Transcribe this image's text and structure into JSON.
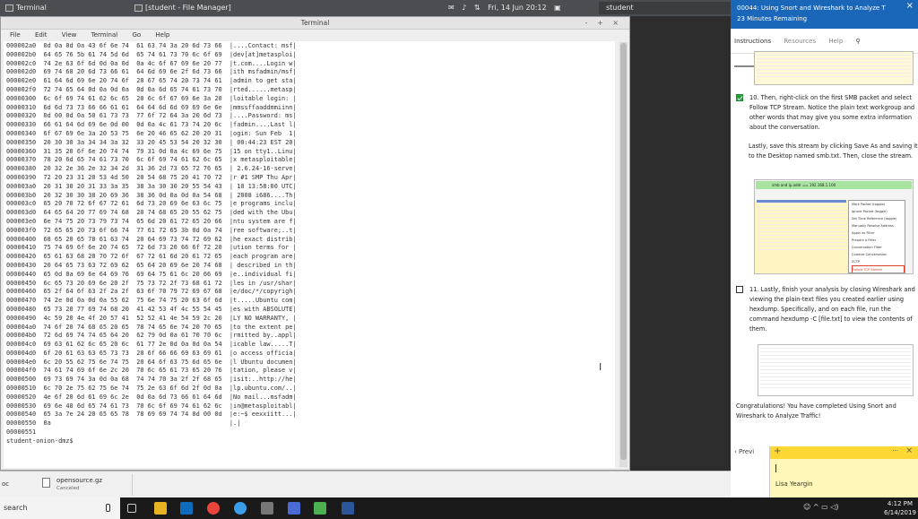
{
  "topbar": {
    "terminal_title": "Terminal",
    "file_manager_title": "[student - File Manager]",
    "datetime": "Fri, 14 Jun  20:12",
    "user": "student"
  },
  "terminal": {
    "title": "Terminal",
    "controls": "- + ×",
    "menu": [
      "File",
      "Edit",
      "View",
      "Terminal",
      "Go",
      "Help"
    ],
    "lines": [
      "000002a0  0d 0a 0d 0a 43 6f 6e 74  61 63 74 3a 20 6d 73 66  |....Contact: msf|",
      "000002b0  64 65 76 5b 61 74 5d 6d  65 74 61 73 70 6c 6f 69  |dev[at]metasploi|",
      "000002c0  74 2e 63 6f 6d 0d 0a 0d  0a 4c 6f 67 69 6e 20 77  |t.com....Login w|",
      "000002d0  69 74 68 20 6d 73 66 61  64 6d 69 6e 2f 6d 73 66  |ith msfadmin/msf|",
      "000002e0  61 64 6d 69 6e 20 74 6f  20 67 65 74 20 73 74 61  |admin to get sta|",
      "000002f0  72 74 65 64 0d 0a 0d 0a  0d 0a 6d 65 74 61 73 70  |rted......metasp|",
      "00000300  6c 6f 69 74 61 62 6c 65  20 6c 6f 67 69 6e 3a 20  |loitable login: |",
      "00000310  6d 6d 73 73 66 66 61 61  64 64 6d 6d 69 69 6e 6e  |mmssffaaddmmiinn|",
      "00000320  0d 00 0d 0a 50 61 73 73  77 6f 72 64 3a 20 6d 73  |....Password: ms|",
      "00000330  66 61 64 6d 69 6e 0d 00  0d 0a 4c 61 73 74 20 6c  |fadmin....Last l|",
      "00000340  6f 67 69 6e 3a 20 53 75  6e 20 46 65 62 20 20 31  |ogin: Sun Feb  1|",
      "00000350  20 30 30 3a 34 34 3a 32  33 20 45 53 54 20 32 30  | 00:44:23 EST 20|",
      "00000360  31 35 20 6f 6e 20 74 74  79 31 0d 0a 4c 69 6e 75  |15 on tty1..Linu|",
      "00000370  78 20 6d 65 74 61 73 70  6c 6f 69 74 61 62 6c 65  |x metasploitable|",
      "00000380  20 32 2e 36 2e 32 34 2d  31 36 2d 73 65 72 76 65  | 2.6.24-16-serve|",
      "00000390  72 20 23 31 20 53 4d 50  20 54 68 75 20 41 70 72  |r #1 SMP Thu Apr|",
      "000003a0  20 31 30 20 31 33 3a 35  38 3a 30 30 20 55 54 43  | 10 13:58:00 UTC|",
      "000003b0  20 32 30 30 38 20 69 36  38 36 0d 0a 0d 0a 54 68  | 2008 i686....Th|",
      "000003c0  65 20 70 72 6f 67 72 61  6d 73 20 69 6e 63 6c 75  |e programs inclu|",
      "000003d0  64 65 64 20 77 69 74 68  20 74 68 65 20 55 62 75  |ded with the Ubu|",
      "000003e0  6e 74 75 20 73 79 73 74  65 6d 20 61 72 65 20 66  |ntu system are f|",
      "000003f0  72 65 65 20 73 6f 66 74  77 61 72 65 3b 0d 0a 74  |ree software;..t|",
      "00000400  68 65 20 65 78 61 63 74  20 64 69 73 74 72 69 62  |he exact distrib|",
      "00000410  75 74 69 6f 6e 20 74 65  72 6d 73 20 66 6f 72 20  |ution terms for |",
      "00000420  65 61 63 68 20 70 72 6f  67 72 61 6d 20 61 72 65  |each program are|",
      "00000430  20 64 65 73 63 72 69 62  65 64 20 69 6e 20 74 68  | described in th|",
      "00000440  65 0d 0a 69 6e 64 69 76  69 64 75 61 6c 20 66 69  |e..individual fi|",
      "00000450  6c 65 73 20 69 6e 20 2f  75 73 72 2f 73 68 61 72  |les in /usr/shar|",
      "00000460  65 2f 64 6f 63 2f 2a 2f  63 6f 70 79 72 69 67 68  |e/doc/*/copyrigh|",
      "00000470  74 2e 0d 0a 0d 0a 55 62  75 6e 74 75 20 63 6f 6d  |t.....Ubuntu com|",
      "00000480  65 73 20 77 69 74 68 20  41 42 53 4f 4c 55 54 45  |es with ABSOLUTE|",
      "00000490  4c 59 20 4e 4f 20 57 41  52 52 41 4e 54 59 2c 20  |LY NO WARRANTY, |",
      "000004a0  74 6f 20 74 68 65 20 65  78 74 65 6e 74 20 70 65  |to the extent pe|",
      "000004b0  72 6d 69 74 74 65 64 20  62 79 0d 0a 61 70 70 6c  |rmitted by..appl|",
      "000004c0  69 63 61 62 6c 65 20 6c  61 77 2e 0d 0a 0d 0a 54  |icable law.....T|",
      "000004d0  6f 20 61 63 63 65 73 73  20 6f 66 66 69 63 69 61  |o access officia|",
      "000004e0  6c 20 55 62 75 6e 74 75  20 64 6f 63 75 6d 65 6e  |l Ubuntu documen|",
      "000004f0  74 61 74 69 6f 6e 2c 20  70 6c 65 61 73 65 20 76  |tation, please v|",
      "00000500  69 73 69 74 3a 0d 0a 68  74 74 70 3a 2f 2f 68 65  |isit:..http://he|",
      "00000510  6c 70 2e 75 62 75 6e 74  75 2e 63 6f 6d 2f 0d 0a  |lp.ubuntu.com/..|",
      "00000520  4e 6f 20 6d 61 69 6c 2e  0d 0a 6d 73 66 61 64 6d  |No mail...msfadm|",
      "00000530  69 6e 40 6d 65 74 61 73  70 6c 6f 69 74 61 62 6c  |in@metasploitabl|",
      "00000540  65 3a 7e 24 20 65 65 78  78 69 69 74 74 0d 00 0d  |e:~$ eexxiitt...|",
      "00000550  0a                                                |.|",
      "00000551",
      "student-onion-dmz$"
    ]
  },
  "panel": {
    "title": "00044: Using Snort and Wireshark to Analyze T",
    "remaining": "23 Minutes Remaining",
    "tabs": [
      "Instructions",
      "Resources",
      "Help"
    ],
    "step10": {
      "number": "10.",
      "text": "Then, right-click on the first SMB packet and select Follow TCP Stream. Notice the plain text workgroup and other words that may give you some extra information about the conversation.",
      "save": "Lastly, save this stream by clicking Save As and saving it to the Desktop named smb.txt. Then, close the stream."
    },
    "step11": {
      "number": "11.",
      "text": "Lastly, finish your analysis by closing Wireshark and viewing the plain-text files you created earlier using hexdump. Specifically, and on each file, run the command hexdump -C [file.txt] to view the contents of them."
    },
    "congrats": "Congratulations! You have completed Using Snort and Wireshark to Analyze Traffic!",
    "prev": "‹ Previ",
    "filter_text": "smb and ip.addr == 192.168.1.100",
    "context_menu": [
      "Mark Packet (toggle)",
      "Ignore Packet (toggle)",
      "Set Time Reference (toggle)",
      "Manually Resolve Address",
      "Apply as Filter",
      "Prepare a Filter",
      "Conversation Filter",
      "Colorize Conversation",
      "SCTP",
      "Follow TCP Stream"
    ]
  },
  "bottom": {
    "left_label": "oc",
    "download_name": "opensource.gz",
    "download_status": "Canceled"
  },
  "sticky": {
    "user": "Lisa Yeargin"
  },
  "taskbar": {
    "search": "search",
    "time": "4:12 PM",
    "date": "6/14/2019"
  },
  "colors": {
    "panel_header": "#1a66b8",
    "check_green": "#22a33a",
    "sticky_yellow": "#fdd835",
    "highlight_red": "#d9432c"
  }
}
